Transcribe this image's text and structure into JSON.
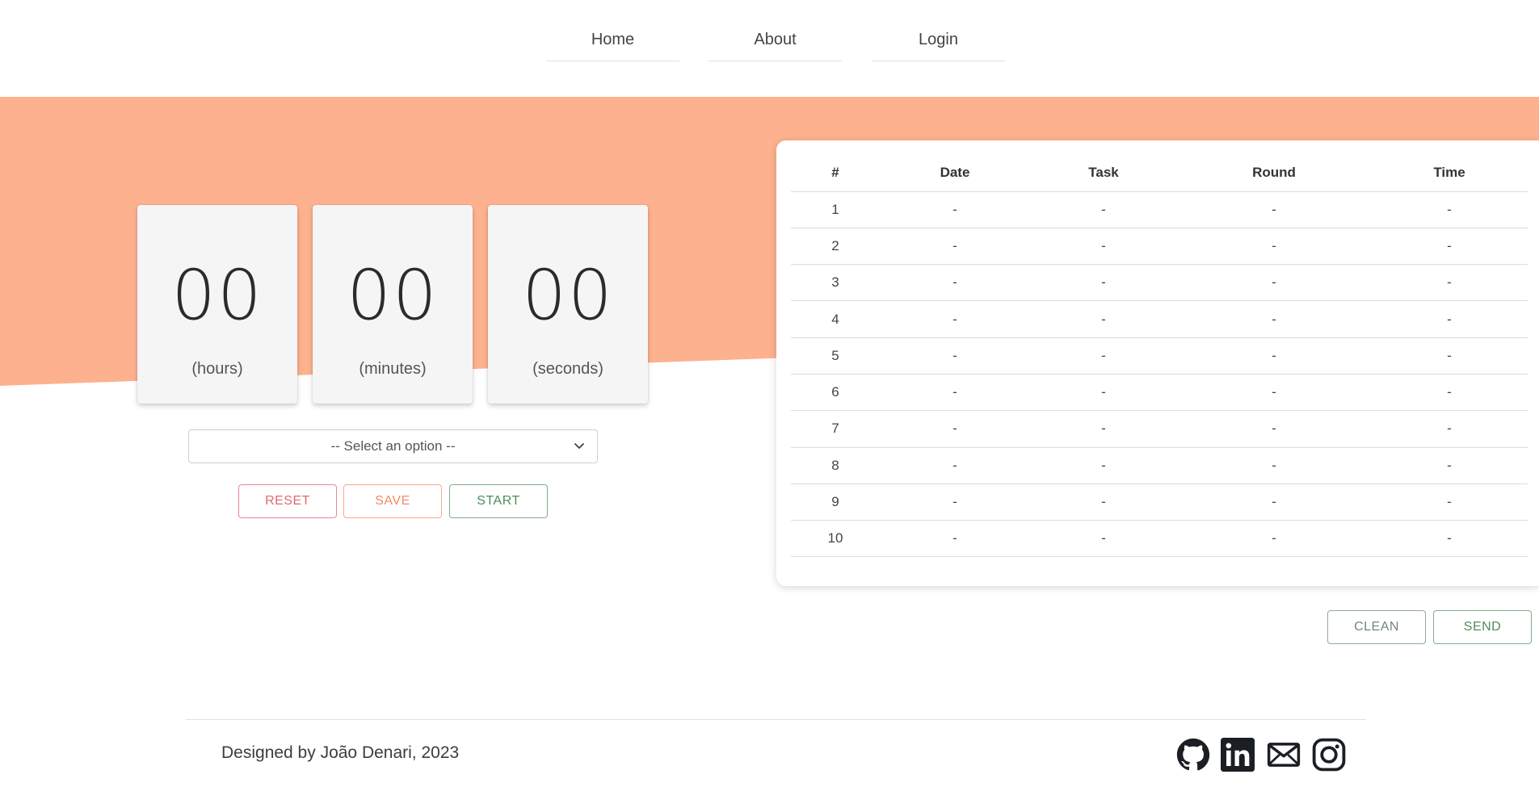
{
  "nav": {
    "items": [
      {
        "label": "Home"
      },
      {
        "label": "About"
      },
      {
        "label": "Login"
      }
    ]
  },
  "colors": {
    "hero": "#fdb18e",
    "reset": "#e06a74",
    "save": "#f28c65",
    "start": "#4e8d5c"
  },
  "timer": {
    "hours": {
      "value": "00",
      "unit": "(hours)"
    },
    "minutes": {
      "value": "00",
      "unit": "(minutes)"
    },
    "seconds": {
      "value": "00",
      "unit": "(seconds)"
    }
  },
  "task_select": {
    "selected": "-- Select an option --",
    "icon": "chevron-down-icon"
  },
  "controls": {
    "reset": "RESET",
    "save": "SAVE",
    "start": "START"
  },
  "table": {
    "headers": [
      "#",
      "Date",
      "Task",
      "Round",
      "Time"
    ],
    "rows": [
      [
        "1",
        "-",
        "-",
        "-",
        "-"
      ],
      [
        "2",
        "-",
        "-",
        "-",
        "-"
      ],
      [
        "3",
        "-",
        "-",
        "-",
        "-"
      ],
      [
        "4",
        "-",
        "-",
        "-",
        "-"
      ],
      [
        "5",
        "-",
        "-",
        "-",
        "-"
      ],
      [
        "6",
        "-",
        "-",
        "-",
        "-"
      ],
      [
        "7",
        "-",
        "-",
        "-",
        "-"
      ],
      [
        "8",
        "-",
        "-",
        "-",
        "-"
      ],
      [
        "9",
        "-",
        "-",
        "-",
        "-"
      ],
      [
        "10",
        "-",
        "-",
        "-",
        "-"
      ]
    ]
  },
  "table_actions": {
    "clean": "CLEAN",
    "send": "SEND"
  },
  "footer": {
    "credit": "Designed by João Denari, 2023",
    "social": [
      "github-icon",
      "linkedin-icon",
      "mail-icon",
      "instagram-icon"
    ]
  }
}
